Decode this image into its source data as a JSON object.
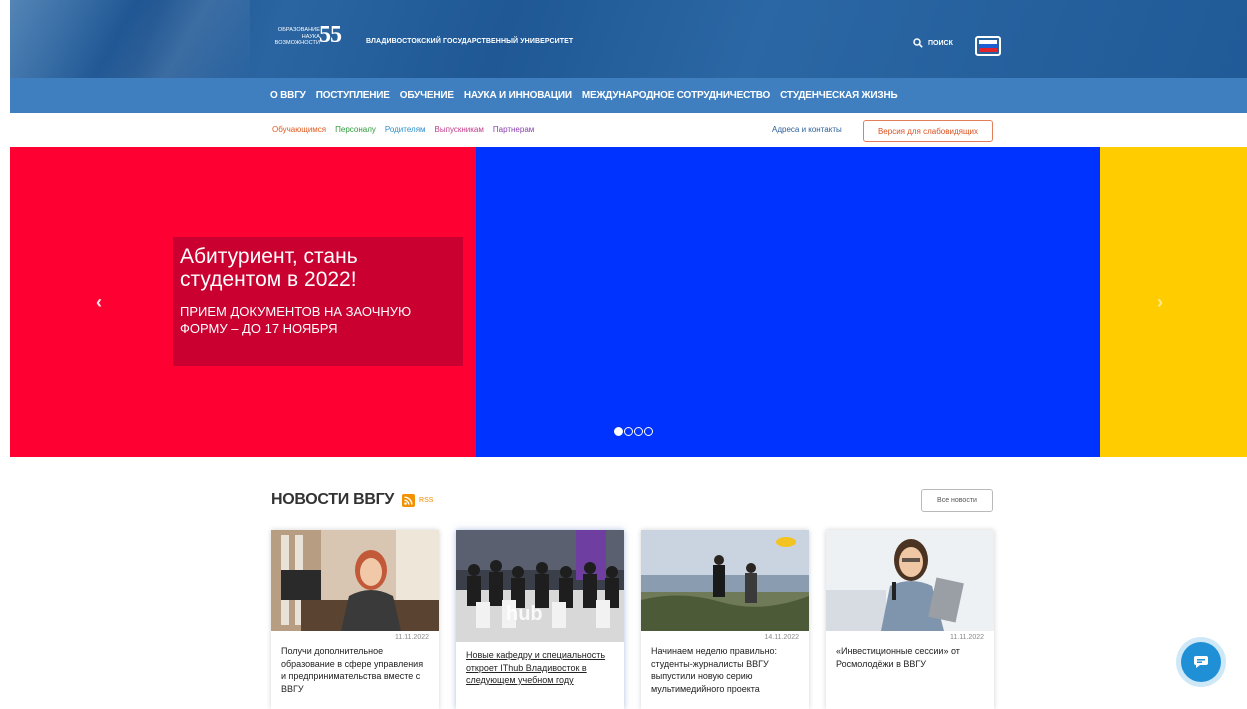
{
  "header": {
    "logo_words": [
      "ОБРАЗОВАНИЕ",
      "НАУКА",
      "ВОЗМОЖНОСТИ"
    ],
    "logo_number": "55",
    "university_name": "ВЛАДИВОСТОКСКИЙ ГОСУДАРСТВЕННЫЙ УНИВЕРСИТЕТ",
    "search_label": "ПОИСК",
    "search_icon": "search-icon",
    "language_icon": "russian-flag-icon"
  },
  "main_nav": {
    "items": [
      {
        "label": "О ВВГУ"
      },
      {
        "label": "ПОСТУПЛЕНИЕ"
      },
      {
        "label": "ОБУЧЕНИЕ"
      },
      {
        "label": "НАУКА И ИННОВАЦИИ"
      },
      {
        "label": "МЕЖДУНАРОДНОЕ СОТРУДНИЧЕСТВО"
      },
      {
        "label": "СТУДЕНЧЕСКАЯ ЖИЗНЬ"
      }
    ]
  },
  "audience_links": [
    {
      "label": "Обучающимся",
      "color": "#e05a1e"
    },
    {
      "label": "Персоналу",
      "color": "#2e9a3a"
    },
    {
      "label": "Родителям",
      "color": "#2f8fc9"
    },
    {
      "label": "Выпускникам",
      "color": "#c03c8a"
    },
    {
      "label": "Партнерам",
      "color": "#8a3fb0"
    }
  ],
  "contacts_link": "Адреса и контакты",
  "low_vision_button": "Версия для слабовидящих",
  "slider": {
    "caption_title": "Абитуриент, стань студентом в 2022!",
    "caption_text": "ПРИЕМ ДОКУМЕНТОВ НА ЗАОЧНУЮ ФОРМУ – ДО 17 НОЯБРЯ",
    "prev_arrow": "‹",
    "next_arrow": "›",
    "slide_count": 4,
    "active_index": 0,
    "colors": {
      "red": "#ff0033",
      "blue": "#0033ff",
      "yellow": "#ffcc00"
    }
  },
  "news": {
    "title": "НОВОСТИ ВВГУ",
    "rss_label": "RSS",
    "all_news_button": "Все новости",
    "items": [
      {
        "date": "11.11.2022",
        "text": "Получи дополнительное образование в сфере управления и предпринимательства вместе с ВВГУ",
        "link": false
      },
      {
        "date": "",
        "text": "Новые кафедру и специальность откроет IThub Владивосток в следующем учебном году",
        "link": true
      },
      {
        "date": "14.11.2022",
        "text": "Начинаем неделю правильно: студенты-журналисты ВВГУ выпустили новую серию мультимедийного проекта",
        "link": false
      },
      {
        "date": "11.11.2022",
        "text": "«Инвестиционные сессии» от Росмолодёжи в ВВГУ",
        "link": false
      }
    ]
  },
  "chat": {
    "icon": "chat-icon"
  }
}
